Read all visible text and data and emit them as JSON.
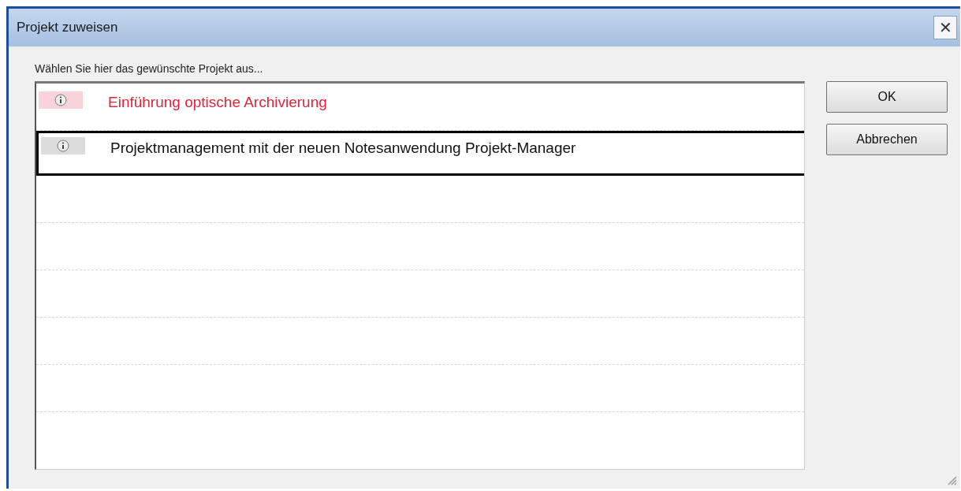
{
  "window": {
    "title": "Projekt zuweisen",
    "close": "✕"
  },
  "prompt": "Wählen Sie hier das gewünschte Projekt aus...",
  "projects": [
    {
      "title": "Einführung optische Archivierung",
      "highlighted": true,
      "selected": false
    },
    {
      "title": "Projektmanagement mit der neuen Notesanwendung Projekt-Manager",
      "highlighted": false,
      "selected": true
    }
  ],
  "buttons": [
    "OK",
    "Abbrechen"
  ]
}
